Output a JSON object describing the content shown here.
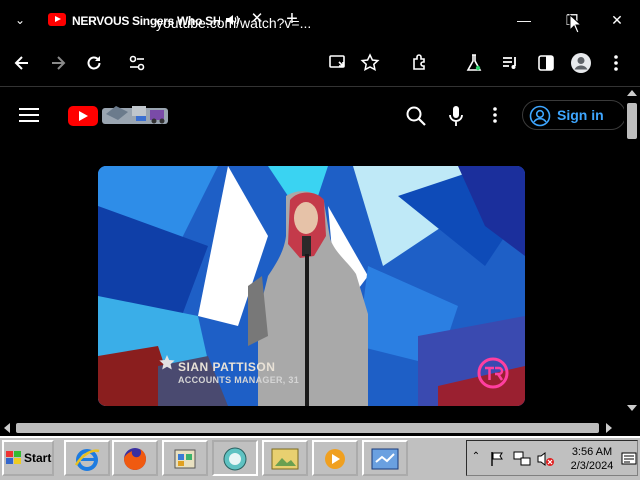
{
  "browser": {
    "tab_title": "NERVOUS Singers Who SH",
    "tab_close": "✕",
    "new_tab": "+",
    "tab_dropdown": "⌄",
    "url": "youtube.com/watch?v=...",
    "window": {
      "minimize": "—",
      "restore": "❐",
      "close": "✕"
    }
  },
  "youtube": {
    "sign_in": "Sign in"
  },
  "video": {
    "caption_name": "SIAN PATTISON",
    "caption_role": "ACCOUNTS MANAGER, 31"
  },
  "taskbar": {
    "start_label": "Start",
    "time": "3:56 AM",
    "date": "2/3/2024"
  },
  "colors": {
    "youtube_red": "#ff0000",
    "link_blue": "#3ea6ff",
    "taskbar_gray": "#c0c0c0"
  }
}
